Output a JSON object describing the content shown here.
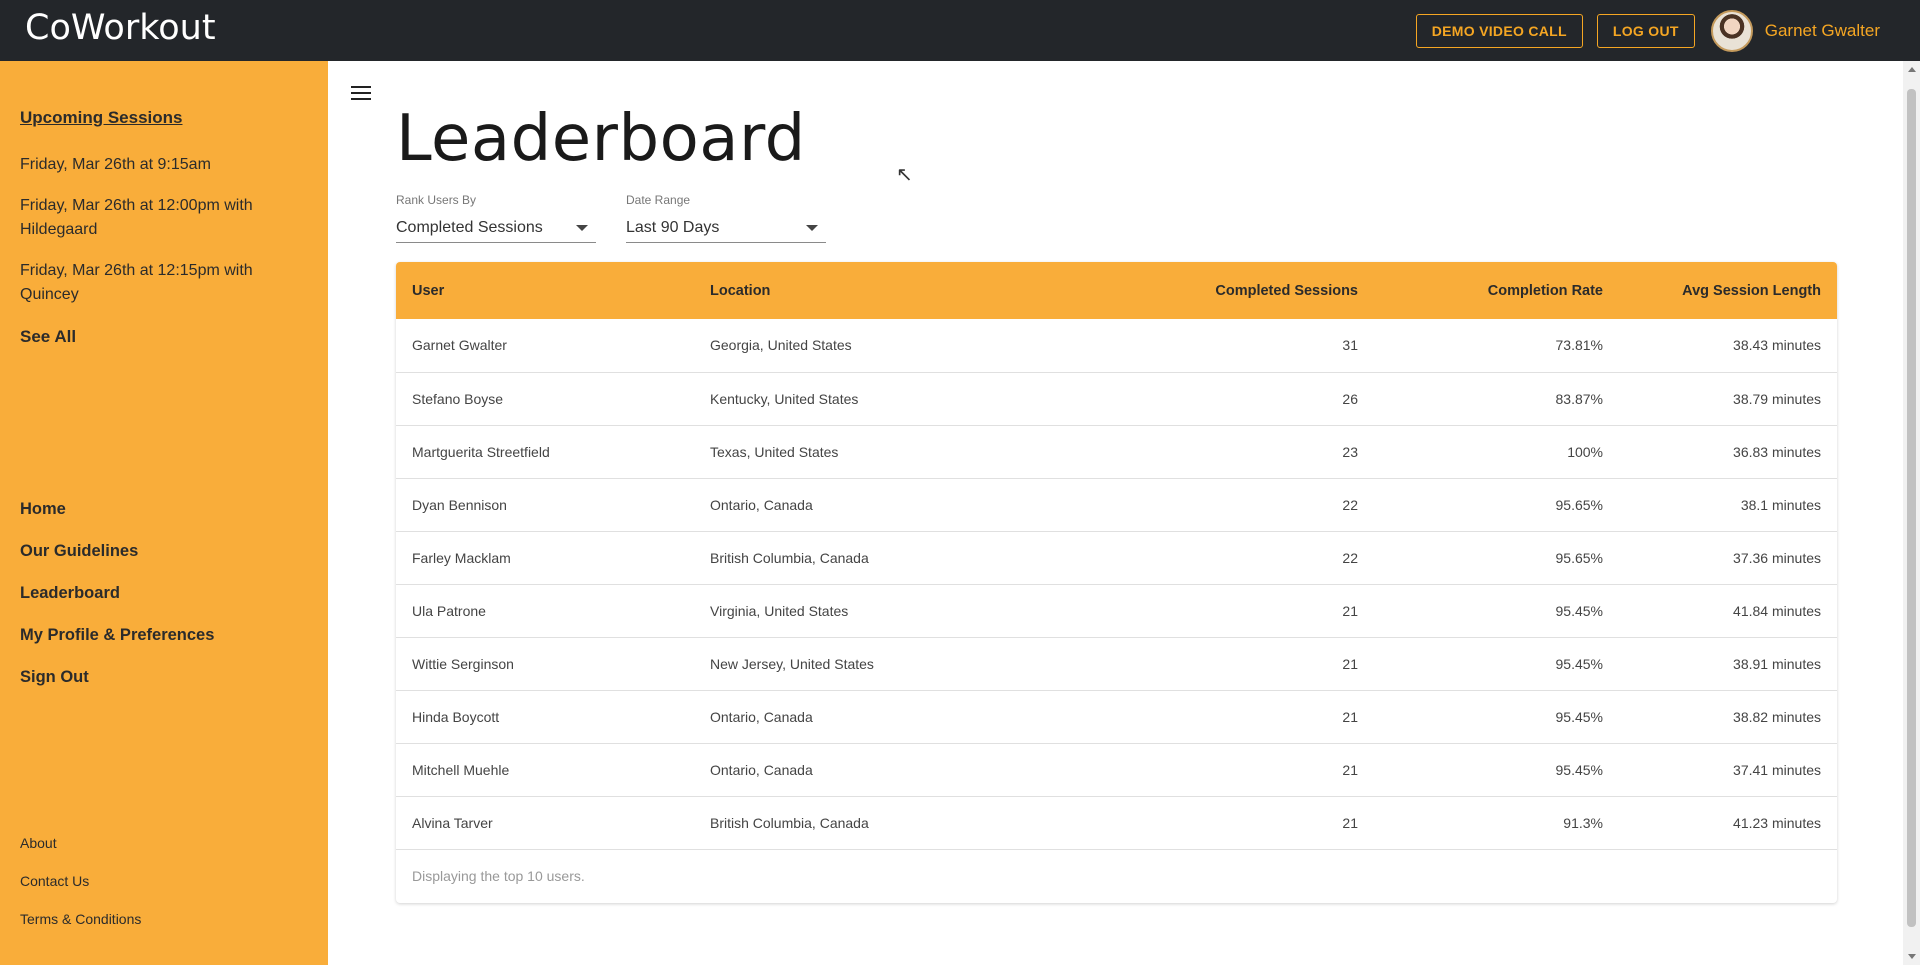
{
  "header": {
    "brand": "CoWorkout",
    "demo_call_label": "DEMO VIDEO CALL",
    "logout_label": "LOG OUT",
    "user_name": "Garnet Gwalter"
  },
  "sidebar": {
    "upcoming_heading": "Upcoming Sessions",
    "sessions": [
      "Friday, Mar 26th at 9:15am",
      "Friday, Mar 26th at 12:00pm with Hildegaard",
      "Friday, Mar 26th at 12:15pm with Quincey"
    ],
    "see_all": "See All",
    "nav": [
      "Home",
      "Our Guidelines",
      "Leaderboard",
      "My Profile & Preferences",
      "Sign Out"
    ],
    "footer": [
      "About",
      "Contact Us",
      "Terms & Conditions"
    ]
  },
  "main": {
    "title": "Leaderboard",
    "rank_by": {
      "label": "Rank Users By",
      "value": "Completed Sessions"
    },
    "date_range": {
      "label": "Date Range",
      "value": "Last 90 Days"
    },
    "table": {
      "headers": [
        "User",
        "Location",
        "Completed Sessions",
        "Completion Rate",
        "Avg Session Length"
      ],
      "rows": [
        [
          "Garnet Gwalter",
          "Georgia, United States",
          "31",
          "73.81%",
          "38.43 minutes"
        ],
        [
          "Stefano Boyse",
          "Kentucky, United States",
          "26",
          "83.87%",
          "38.79 minutes"
        ],
        [
          "Martguerita Streetfield",
          "Texas, United States",
          "23",
          "100%",
          "36.83 minutes"
        ],
        [
          "Dyan Bennison",
          "Ontario, Canada",
          "22",
          "95.65%",
          "38.1 minutes"
        ],
        [
          "Farley Macklam",
          "British Columbia, Canada",
          "22",
          "95.65%",
          "37.36 minutes"
        ],
        [
          "Ula Patrone",
          "Virginia, United States",
          "21",
          "95.45%",
          "41.84 minutes"
        ],
        [
          "Wittie Serginson",
          "New Jersey, United States",
          "21",
          "95.45%",
          "38.91 minutes"
        ],
        [
          "Hinda Boycott",
          "Ontario, Canada",
          "21",
          "95.45%",
          "38.82 minutes"
        ],
        [
          "Mitchell Muehle",
          "Ontario, Canada",
          "21",
          "95.45%",
          "37.41 minutes"
        ],
        [
          "Alvina Tarver",
          "British Columbia, Canada",
          "21",
          "91.3%",
          "41.23 minutes"
        ]
      ],
      "footer": "Displaying the top 10 users."
    }
  },
  "colors": {
    "accent": "#f9ad3a",
    "topbar": "#23262a",
    "button_text": "#f5a623"
  }
}
